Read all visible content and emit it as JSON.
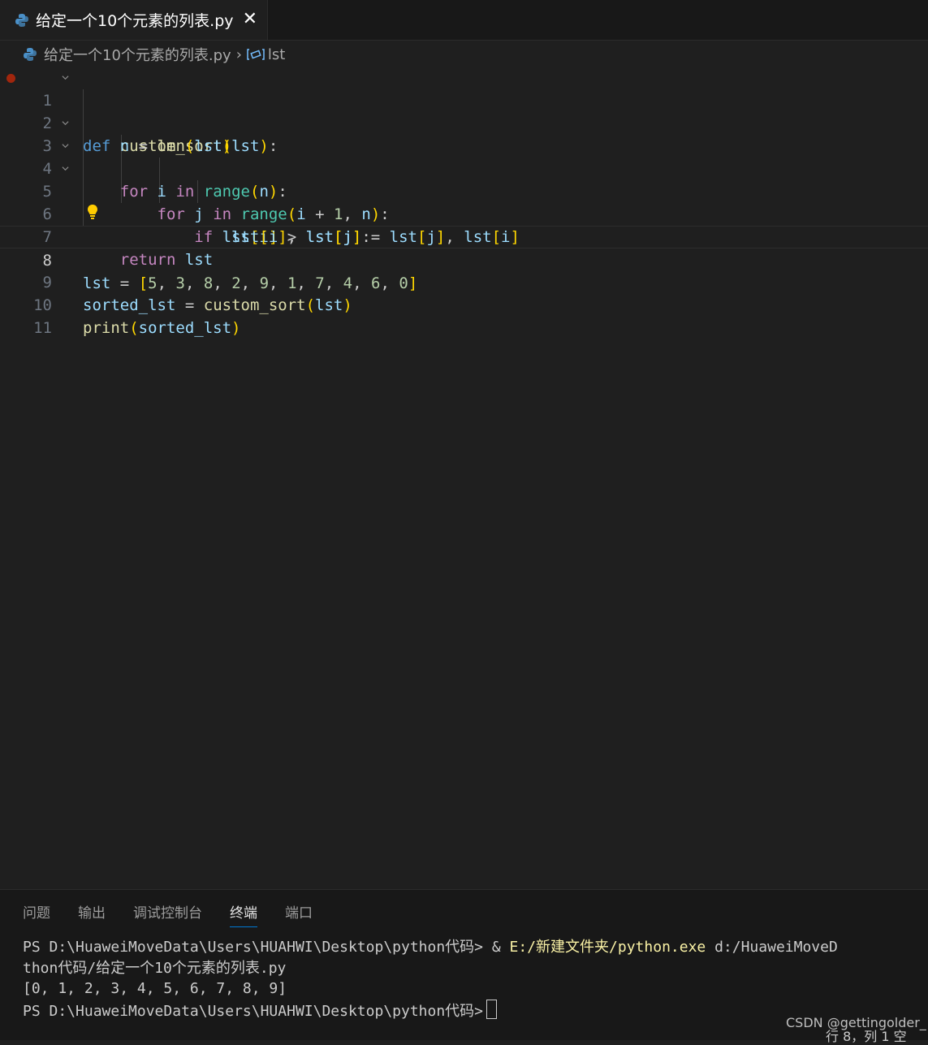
{
  "tab": {
    "title": "给定一个10个元素的列表.py",
    "close": "✕"
  },
  "breadcrumb": {
    "file": "给定一个10个元素的列表.py",
    "separator": "›",
    "symbol": "lst"
  },
  "editor": {
    "line_numbers": [
      "1",
      "2",
      "3",
      "4",
      "5",
      "6",
      "7",
      "8",
      "9",
      "10",
      "11"
    ],
    "current_line": 8
  },
  "panel": {
    "tabs": [
      "问题",
      "输出",
      "调试控制台",
      "终端",
      "端口"
    ],
    "active_tab": "终端",
    "terminal": {
      "line1_prompt": "PS D:\\HuaweiMoveData\\Users\\HUAHWI\\Desktop\\python代码> & ",
      "line1_exe": "E:/新建文件夹/python.exe",
      "line1_arg": " d:/HuaweiMoveD",
      "line2": "thon代码/给定一个10个元素的列表.py",
      "line3": "[0, 1, 2, 3, 4, 5, 6, 7, 8, 9]",
      "line4": "PS D:\\HuaweiMoveData\\Users\\HUAHWI\\Desktop\\python代码>"
    }
  },
  "watermark": "CSDN @gettingolder_",
  "status": "行 8，列 1   空"
}
